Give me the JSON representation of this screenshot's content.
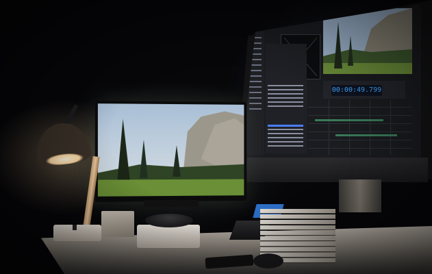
{
  "scene": {
    "description_tags": [
      "dark-room",
      "desk-lamp",
      "dual-monitor",
      "video-editing"
    ]
  },
  "editor_ui": {
    "timecode": "00:00:49.799",
    "timecode_color": "#3fa6ff"
  },
  "colors": {
    "lamp_glow": "#ffd9a0",
    "desk": "#d7cfc4",
    "accent_blue": "#4a7dff",
    "landscape_sky": "#9fb6cf",
    "landscape_grass": "#5b7a3a"
  }
}
